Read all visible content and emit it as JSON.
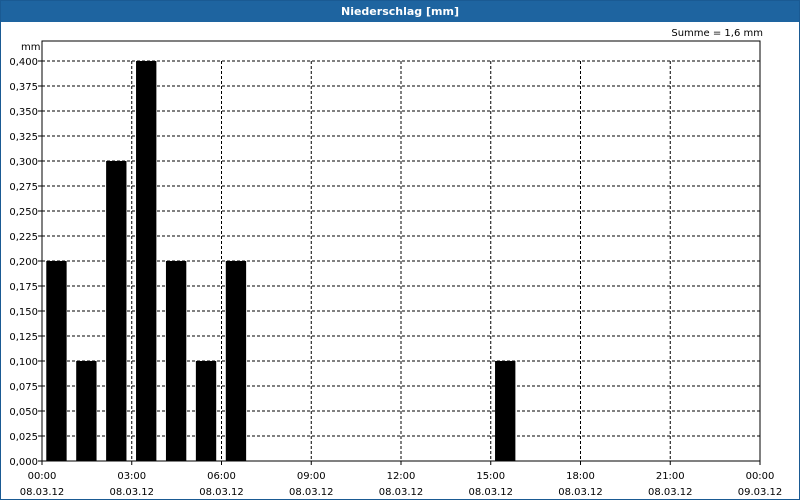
{
  "window": {
    "title": "Niederschlag [mm]"
  },
  "summary": {
    "text": "Summe = 1,6 mm"
  },
  "chart_data": {
    "type": "bar",
    "title": "Niederschlag [mm]",
    "ylabel": "mm",
    "xlabel": "",
    "ylim": [
      0,
      0.4
    ],
    "y_ticks": [
      "0,000",
      "0,025",
      "0,050",
      "0,075",
      "0,100",
      "0,125",
      "0,150",
      "0,175",
      "0,200",
      "0,225",
      "0,250",
      "0,275",
      "0,300",
      "0,325",
      "0,350",
      "0,375",
      "0,400"
    ],
    "x_ticks": [
      {
        "time": "00:00",
        "date": "08.03.12"
      },
      {
        "time": "03:00",
        "date": "08.03.12"
      },
      {
        "time": "06:00",
        "date": "08.03.12"
      },
      {
        "time": "09:00",
        "date": "08.03.12"
      },
      {
        "time": "12:00",
        "date": "08.03.12"
      },
      {
        "time": "15:00",
        "date": "08.03.12"
      },
      {
        "time": "18:00",
        "date": "08.03.12"
      },
      {
        "time": "21:00",
        "date": "08.03.12"
      },
      {
        "time": "00:00",
        "date": "09.03.12"
      }
    ],
    "xlim": [
      "08.03.12 00:00",
      "09.03.12 00:00"
    ],
    "bar_interval_hours": 1,
    "grid": true,
    "bar_color": "#000000",
    "series": [
      {
        "values": [
          {
            "hour": 0,
            "value": 0.2
          },
          {
            "hour": 1,
            "value": 0.1
          },
          {
            "hour": 2,
            "value": 0.3
          },
          {
            "hour": 3,
            "value": 0.4
          },
          {
            "hour": 4,
            "value": 0.2
          },
          {
            "hour": 5,
            "value": 0.1
          },
          {
            "hour": 6,
            "value": 0.2
          },
          {
            "hour": 15,
            "value": 0.1
          }
        ]
      }
    ]
  }
}
